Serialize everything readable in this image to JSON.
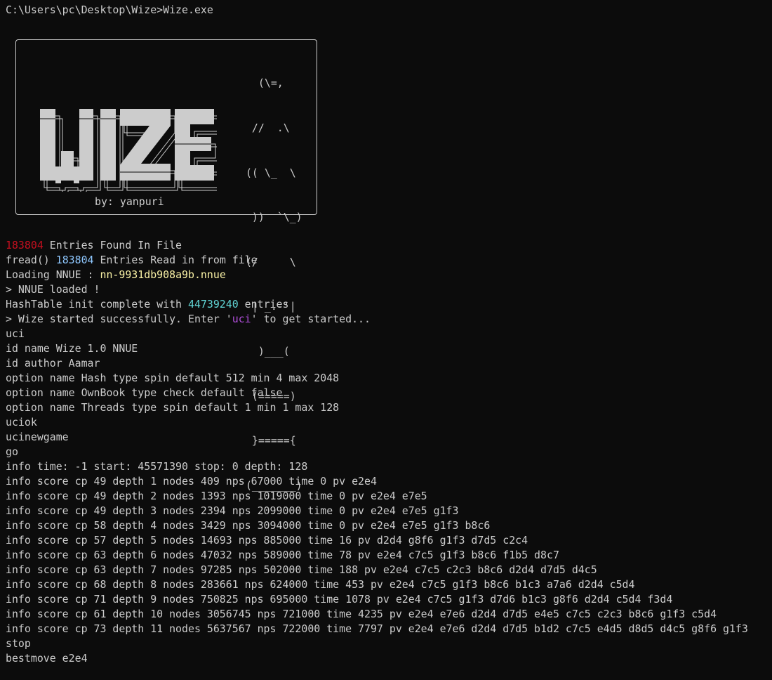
{
  "window": {
    "prompt": "C:\\Users\\pc\\Desktop\\Wize>Wize.exe"
  },
  "banner": {
    "logo_text": "WIZE",
    "author": "by: yanpuri",
    "ascii_art": [
      "   (\\=,",
      "  //  .\\",
      " (( \\_  \\",
      "  ))  `\\_)",
      " (/     \\",
      "  | _.-'|",
      "   )___(",
      "  (=====)",
      "  }====={",
      " (_______)"
    ]
  },
  "startup": {
    "entries_count": "183804",
    "entries_found_text": " Entries Found In File",
    "fread_prefix": "fread() ",
    "fread_count": "183804",
    "fread_suffix": " Entries Read in from file",
    "nnue_prefix": "Loading NNUE : ",
    "nnue_file": "nn-9931db908a9b.nnue",
    "nnue_loaded": "> NNUE loaded !",
    "hash_prefix": "HashTable init complete with ",
    "hash_count": "44739240",
    "hash_suffix": " entries",
    "started_prefix": "> Wize started successfully. Enter '",
    "started_cmd": "uci",
    "started_suffix": "' to get started..."
  },
  "output_lines": [
    "uci",
    "id name Wize 1.0 NNUE",
    "id author Aamar",
    "option name Hash type spin default 512 min 4 max 2048",
    "option name OwnBook type check default false",
    "option name Threads type spin default 1 min 1 max 128",
    "uciok",
    "ucinewgame",
    "go",
    "info time: -1 start: 45571390 stop: 0 depth: 128",
    "info score cp 49 depth 1 nodes 409 nps 67000 time 0 pv e2e4",
    "info score cp 49 depth 2 nodes 1393 nps 1019000 time 0 pv e2e4 e7e5",
    "info score cp 49 depth 3 nodes 2394 nps 2099000 time 0 pv e2e4 e7e5 g1f3",
    "info score cp 58 depth 4 nodes 3429 nps 3094000 time 0 pv e2e4 e7e5 g1f3 b8c6",
    "info score cp 57 depth 5 nodes 14693 nps 885000 time 16 pv d2d4 g8f6 g1f3 d7d5 c2c4",
    "info score cp 63 depth 6 nodes 47032 nps 589000 time 78 pv e2e4 c7c5 g1f3 b8c6 f1b5 d8c7",
    "info score cp 63 depth 7 nodes 97285 nps 502000 time 188 pv e2e4 c7c5 c2c3 b8c6 d2d4 d7d5 d4c5",
    "info score cp 68 depth 8 nodes 283661 nps 624000 time 453 pv e2e4 c7c5 g1f3 b8c6 b1c3 a7a6 d2d4 c5d4",
    "info score cp 71 depth 9 nodes 750825 nps 695000 time 1078 pv e2e4 c7c5 g1f3 d7d6 b1c3 g8f6 d2d4 c5d4 f3d4",
    "info score cp 61 depth 10 nodes 3056745 nps 721000 time 4235 pv e2e4 e7e6 d2d4 d7d5 e4e5 c7c5 c2c3 b8c6 g1f3 c5d4",
    "info score cp 73 depth 11 nodes 5637567 nps 722000 time 7797 pv e2e4 e7e6 d2d4 d7d5 b1d2 c7c5 e4d5 d8d5 d4c5 g8f6 g1f3",
    "stop",
    "bestmove e2e4"
  ],
  "colors": {
    "background": "#0c0c0c",
    "foreground": "#cccccc",
    "red": "#c50f1f",
    "cyan": "#61d6d6",
    "light_blue": "#8fc8ff",
    "yellow": "#f9f1a5",
    "purple": "#b24fdc"
  }
}
